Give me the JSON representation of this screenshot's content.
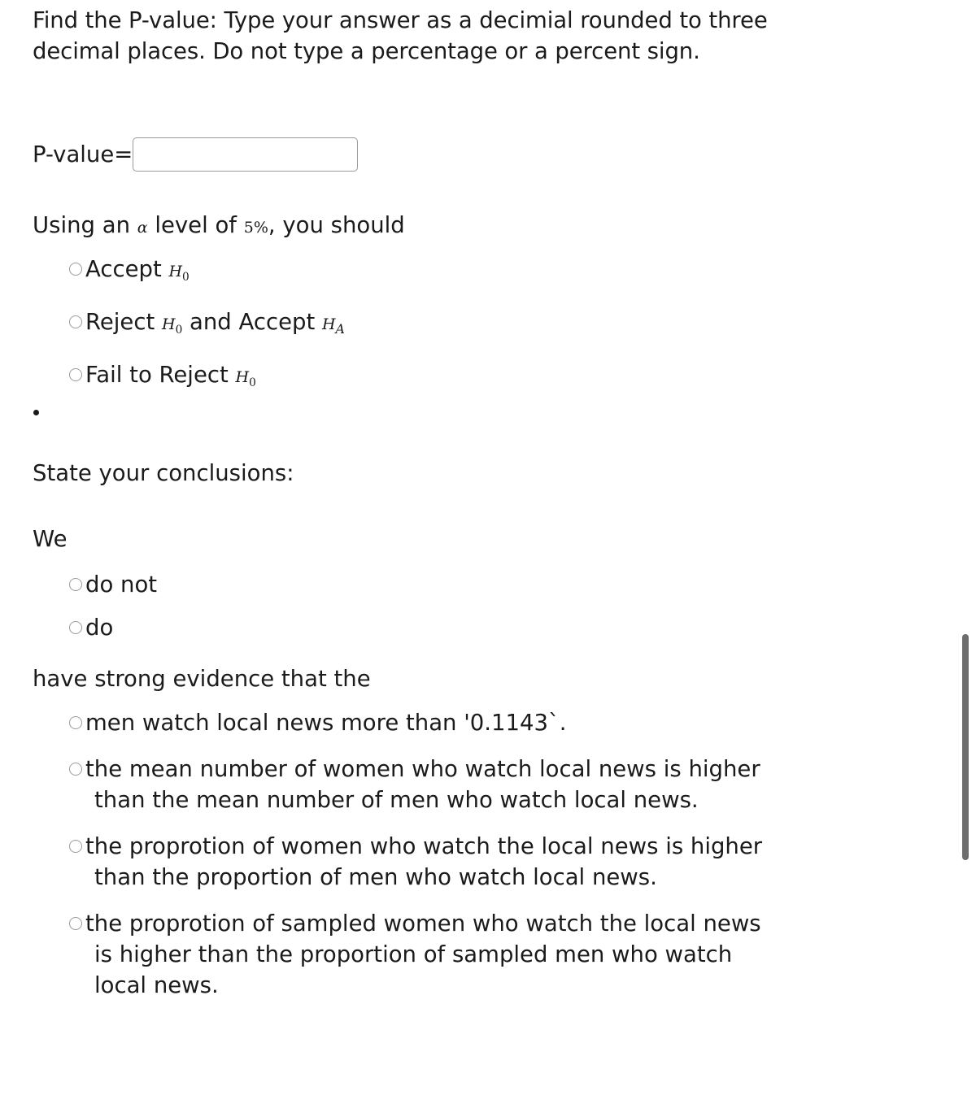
{
  "prompt": {
    "text": "Find the P-value: Type your answer as a decimial rounded to three decimal places. Do not type a percentage or a percent sign."
  },
  "pvalue": {
    "label": "P-value=",
    "value": "",
    "placeholder": ""
  },
  "alpha_section": {
    "lead_1": "Using an ",
    "alpha_symbol": "α",
    "lead_2": " level of ",
    "level_value": "5",
    "percent_symbol": "%",
    "lead_3": ", you should",
    "options": [
      {
        "prefix": "Accept ",
        "symbol": "H",
        "subscript": "0",
        "suffix": ""
      },
      {
        "prefix": "Reject ",
        "symbol": "H",
        "subscript": "0",
        "middle": " and Accept ",
        "symbol2": "H",
        "subscript2": "A",
        "suffix": ""
      },
      {
        "prefix": "Fail to Reject ",
        "symbol": "H",
        "subscript": "0",
        "suffix": ""
      }
    ]
  },
  "bullet": {
    "glyph": "•"
  },
  "conclusions": {
    "heading": "State your conclusions:",
    "we_word": "We",
    "we_options": [
      {
        "label": "do not"
      },
      {
        "label": "do"
      }
    ],
    "connector": "have strong evidence that the",
    "options": [
      {
        "line1": "men watch local news more than '0.1143`.",
        "line2": ""
      },
      {
        "line1": "the mean number of women who watch local news is higher",
        "line2": "than the mean number of men who watch local news."
      },
      {
        "line1": "the proprotion of women who watch the local news is higher",
        "line2": "than the proportion of men who watch local news."
      },
      {
        "line1": "the proprotion of sampled women who watch the local news",
        "line2": "is higher than the proportion of sampled men who watch",
        "line3": "local news."
      }
    ]
  },
  "scrollbar": {
    "thumb_color": "#6d6d6d"
  }
}
